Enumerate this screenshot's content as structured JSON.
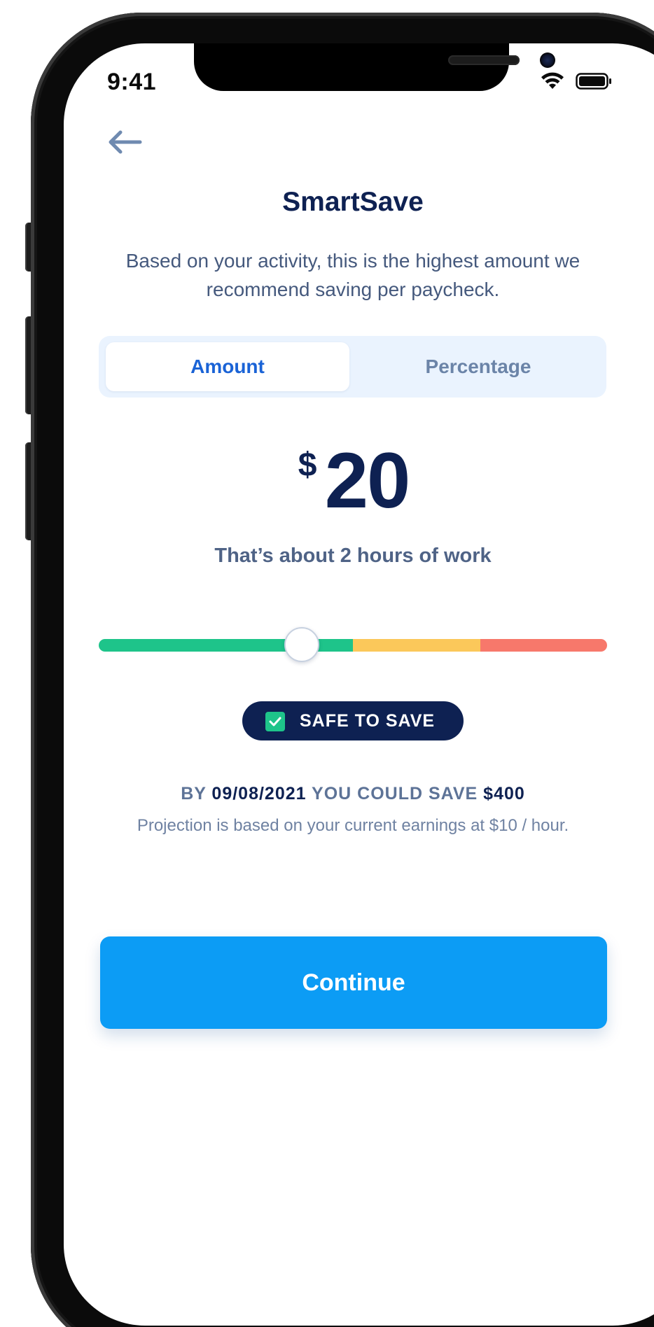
{
  "status_bar": {
    "time": "9:41",
    "icons": [
      "wifi-icon",
      "battery-icon"
    ]
  },
  "nav": {
    "back_icon": "arrow-left-icon"
  },
  "header": {
    "title": "SmartSave",
    "subtitle": "Based on your activity, this is the highest amount we recommend saving per paycheck."
  },
  "segmented_control": {
    "options": [
      {
        "label": "Amount",
        "selected": true
      },
      {
        "label": "Percentage",
        "selected": false
      }
    ]
  },
  "amount": {
    "currency": "$",
    "value": "20"
  },
  "work_hint": "That’s about 2 hours of work",
  "slider": {
    "value_fraction": 0.4,
    "zones": [
      {
        "name": "safe",
        "fraction": 0.5,
        "color": "#1ec48a"
      },
      {
        "name": "caution",
        "fraction": 0.25,
        "color": "#fbc85a"
      },
      {
        "name": "risky",
        "fraction": 0.25,
        "color": "#f7786b"
      }
    ]
  },
  "badge": {
    "label": "SAFE TO SAVE",
    "icon": "check-icon",
    "check_color": "#1ec48a"
  },
  "projection": {
    "prefix": "BY",
    "date": "09/08/2021",
    "middle": "YOU COULD SAVE",
    "amount": "$400",
    "note": "Projection is based on your current earnings at $10 / hour."
  },
  "actions": {
    "continue_label": "Continue"
  },
  "colors": {
    "primary": "#0c9cf5",
    "navy": "#0e2152",
    "segment_bg": "#eaf3fe",
    "selected_text": "#1a63d6"
  }
}
